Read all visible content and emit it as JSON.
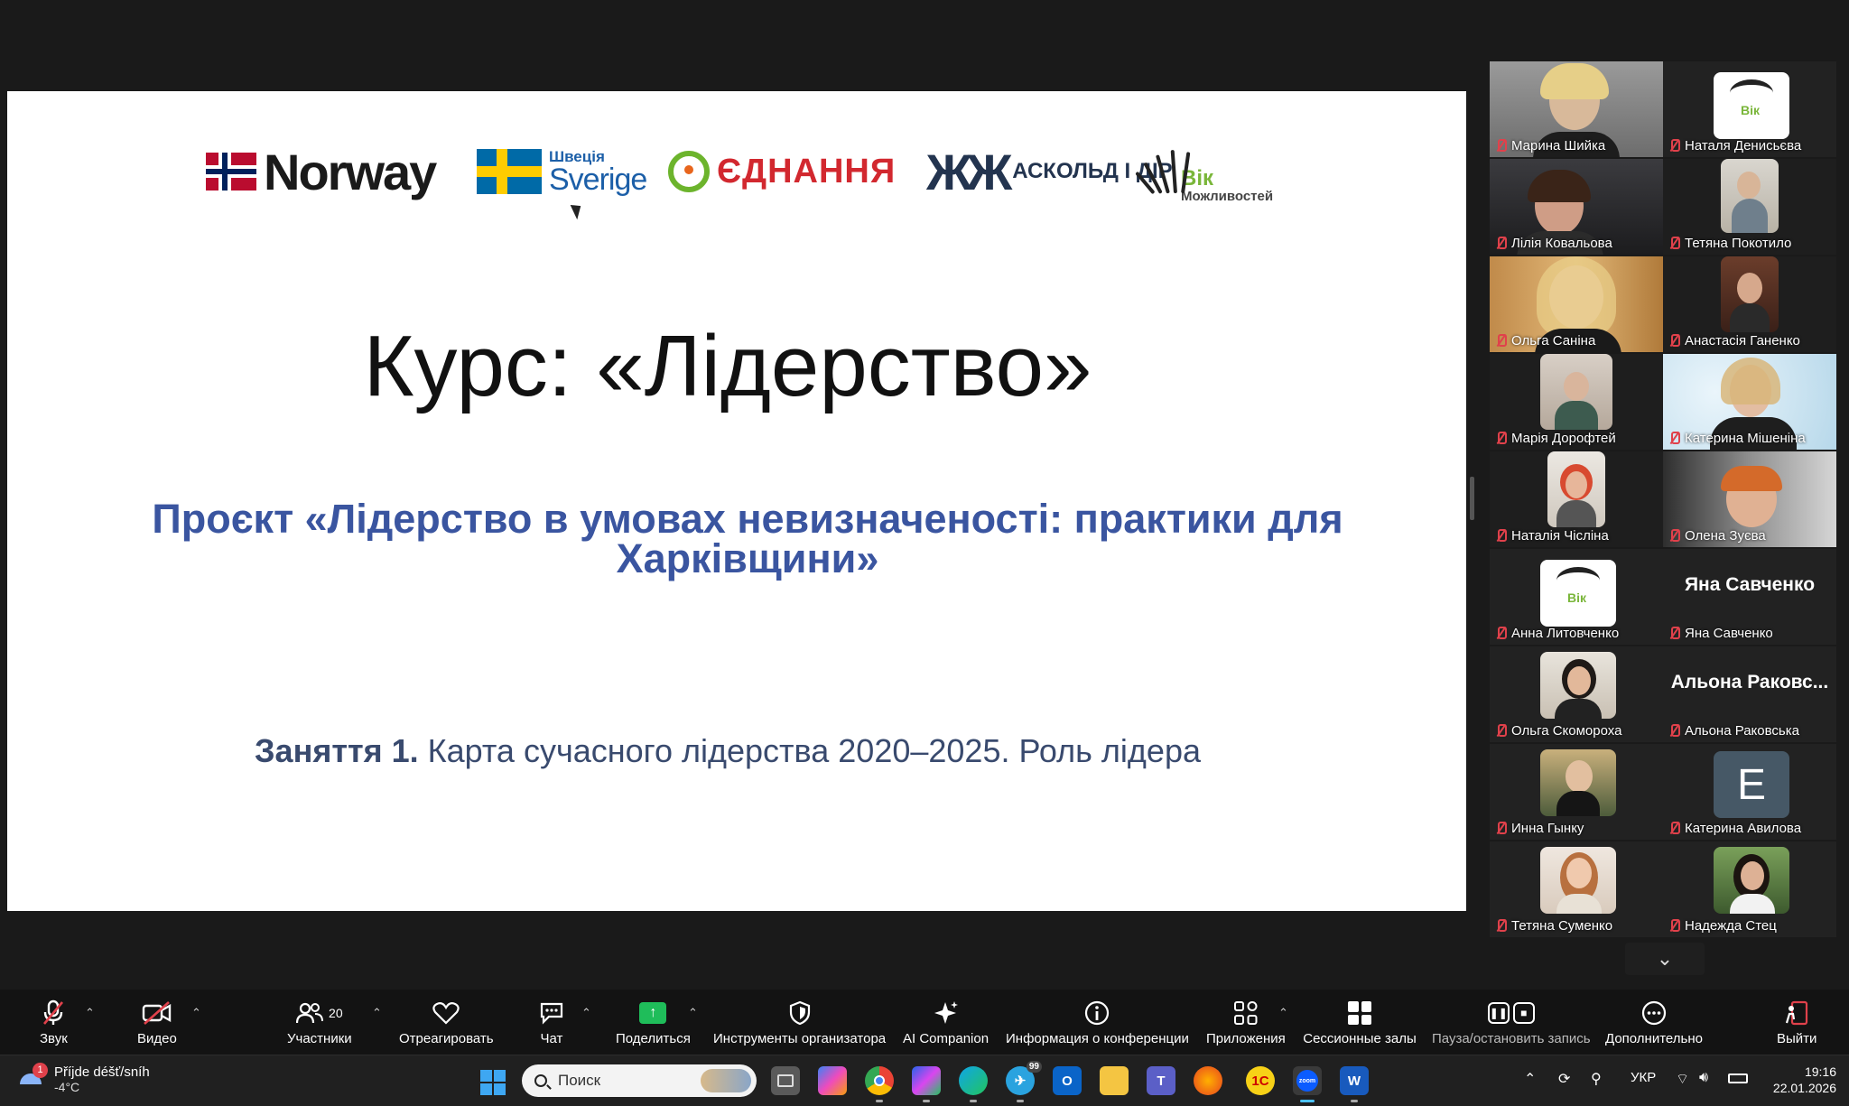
{
  "slide": {
    "logos": {
      "norway": "Norway",
      "sweden_small": "Швеція",
      "sweden_big": "Sverige",
      "ednannya": "ЄДНАННЯ",
      "askold": "АСКОЛЬД І ДІР",
      "vik_top": "Вік",
      "vik_bottom": "Можливостей"
    },
    "title": "Курс: «Лідерство»",
    "project": "Проєкт «Лідерство в умовах невизначеності: практики для Харківщини»",
    "lesson_bold": "Заняття 1.",
    "lesson_rest": " Карта сучасного лідерства 2020–2025. Роль лідера"
  },
  "participants": [
    {
      "name": "Марина Шийка",
      "kind": "video"
    },
    {
      "name": "Наталя Денисьєва",
      "kind": "avatar-logo"
    },
    {
      "name": "Лілія Ковальова",
      "kind": "video"
    },
    {
      "name": "Тетяна Покотило",
      "kind": "video"
    },
    {
      "name": "Ольга Саніна",
      "kind": "video"
    },
    {
      "name": "Анастасія Ганенко",
      "kind": "video"
    },
    {
      "name": "Марія Дорофтей",
      "kind": "video"
    },
    {
      "name": "Катерина Мішеніна",
      "kind": "video",
      "active": true
    },
    {
      "name": "Наталія Чіслінa",
      "kind": "video"
    },
    {
      "name": "Олена Зуєва",
      "kind": "video"
    },
    {
      "name": "Анна Литовченко",
      "kind": "avatar-logo"
    },
    {
      "name": "Яна Савченко",
      "kind": "name-only",
      "display": "Яна Савченко"
    },
    {
      "name": "Ольга Скомороха",
      "kind": "avatar-photo"
    },
    {
      "name": "Альона Раковська",
      "kind": "name-only",
      "display": "Альона Раковс..."
    },
    {
      "name": "Инна Гынку",
      "kind": "avatar-photo"
    },
    {
      "name": "Катерина Авилова",
      "kind": "avatar-letter",
      "letter": "E"
    },
    {
      "name": "Тетяна Суменко",
      "kind": "avatar-photo"
    },
    {
      "name": "Надежда Стец",
      "kind": "avatar-photo"
    }
  ],
  "toolbar": {
    "audio": "Звук",
    "video": "Видео",
    "participants": "Участники",
    "participants_count": "20",
    "react": "Отреагировать",
    "chat": "Чат",
    "share": "Поделиться",
    "host_tools": "Инструменты организатора",
    "ai": "AI Companion",
    "info": "Информация о конференции",
    "apps": "Приложения",
    "breakout": "Сессионные залы",
    "record": "Пауза/остановить запись",
    "more": "Дополнительно",
    "leave": "Выйти"
  },
  "taskbar": {
    "weather_title": "Příjde déšť/sníh",
    "weather_temp": "-4°C",
    "weather_badge": "1",
    "search_placeholder": "Поиск",
    "telegram_badge": "99",
    "language": "УКР",
    "time": "19:16",
    "date": "22.01.2026"
  },
  "colors": {
    "accent_green": "#3ecf6c",
    "mute_red": "#e0414b",
    "project_blue": "#3a55a0"
  }
}
